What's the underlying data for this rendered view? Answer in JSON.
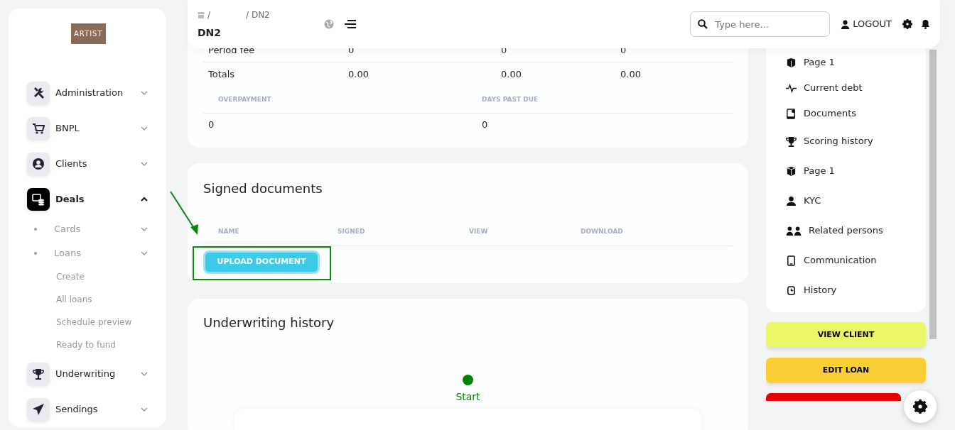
{
  "navbar": {
    "breadcrumb": [
      "/",
      "/ DN2"
    ],
    "title": "DN2",
    "search": {
      "placeholder": "Type here..."
    },
    "logout": "LOGOUT"
  },
  "sidebar": {
    "logo": "ARTIST",
    "items": [
      {
        "label": "Administration",
        "selected": false,
        "expanded": false
      },
      {
        "label": "BNPL",
        "selected": false,
        "expanded": false
      },
      {
        "label": "Clients",
        "selected": false,
        "expanded": false
      },
      {
        "label": "Deals",
        "selected": true,
        "expanded": true,
        "children": [
          {
            "label": "Cards",
            "kind": "group",
            "expanded": false
          },
          {
            "label": "Loans",
            "kind": "group",
            "expanded": false
          },
          {
            "label": "Create",
            "kind": "link"
          },
          {
            "label": "All loans",
            "kind": "link"
          },
          {
            "label": "Schedule preview",
            "kind": "link"
          },
          {
            "label": "Ready to fund",
            "kind": "link"
          }
        ]
      },
      {
        "label": "Underwriting",
        "selected": false,
        "expanded": false
      },
      {
        "label": "Sendings",
        "selected": false,
        "expanded": false
      }
    ]
  },
  "payments_card": {
    "rows": [
      [
        "Period fee",
        "0",
        "0",
        "0"
      ],
      [
        "Totals",
        "0.00",
        "0.00",
        "0.00"
      ]
    ],
    "summary": {
      "columns": [
        "OVERPAYMENT",
        "DAYS PAST DUE"
      ],
      "values": [
        "0",
        "0"
      ]
    }
  },
  "signed_documents": {
    "title": "Signed documents",
    "columns": [
      "NAME",
      "SIGNED",
      "VIEW",
      "DOWNLOAD"
    ],
    "upload_button": "UPLOAD DOCUMENT"
  },
  "underwriting_history": {
    "title": "Underwriting history",
    "steps": [
      {
        "label": "Start",
        "color": "#008000"
      }
    ]
  },
  "right_menu": {
    "items": [
      "Page 1",
      "Current debt",
      "Documents",
      "Scoring history",
      "Page 1",
      "KYC",
      "Related persons",
      "Communication",
      "History"
    ],
    "buttons": [
      {
        "label": "VIEW CLIENT",
        "color": "#eaf56a"
      },
      {
        "label": "EDIT LOAN",
        "color": "#f9cf35"
      },
      {
        "color": "#e60000"
      }
    ]
  }
}
